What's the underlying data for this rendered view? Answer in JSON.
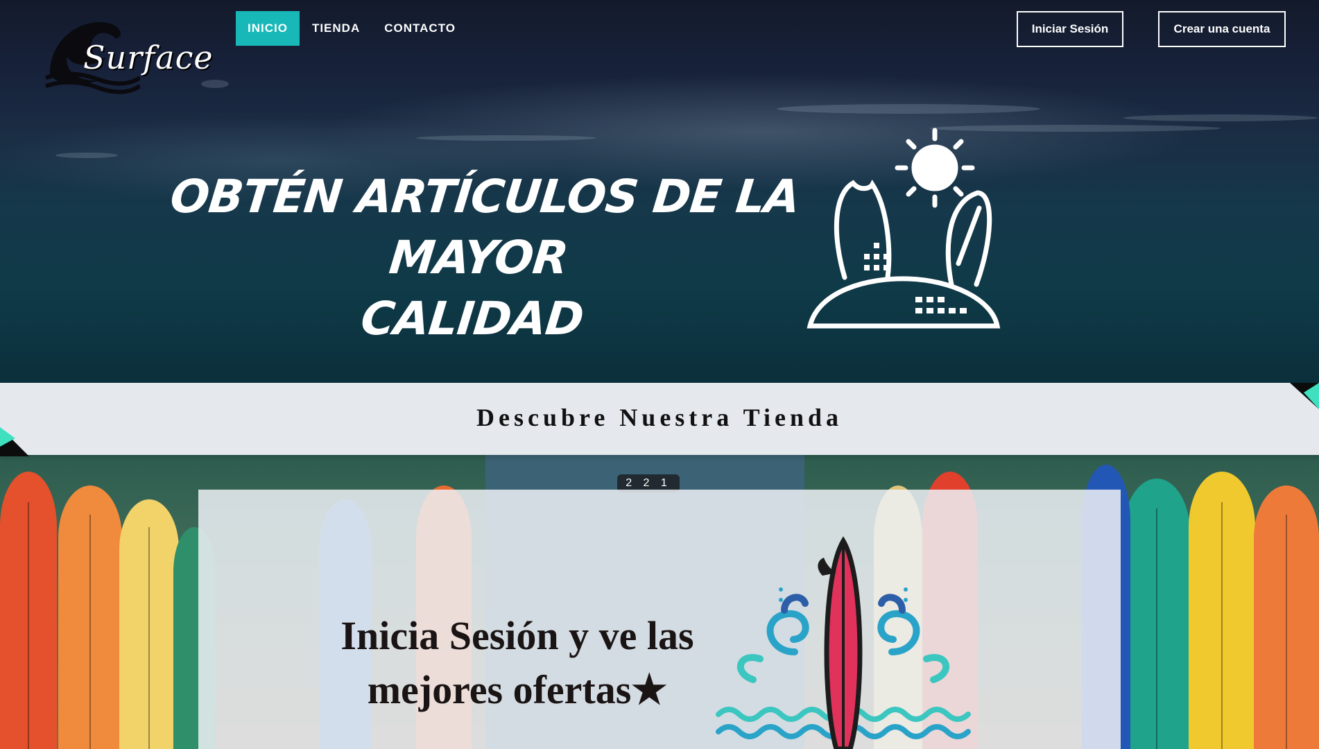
{
  "brand": {
    "name": "Surface"
  },
  "nav": {
    "items": [
      {
        "label": "INICIO",
        "active": true
      },
      {
        "label": "TIENDA",
        "active": false
      },
      {
        "label": "CONTACTO",
        "active": false
      }
    ]
  },
  "auth": {
    "login_label": "Iniciar Sesión",
    "signup_label": "Crear una cuenta"
  },
  "hero": {
    "headline_line1": "OBTÉN ARTÍCULOS DE LA MAYOR",
    "headline_line2": "CALIDAD",
    "icon": "beach-surfboards-icon"
  },
  "banner": {
    "title": "Descubre Nuestra Tienda"
  },
  "surf_wall": {
    "house_number": "2 2 1"
  },
  "promo": {
    "headline_line1": "Inicia Sesión y ve las",
    "headline_line2": "mejores ofertas★",
    "icon": "surfboard-wave-icon"
  },
  "colors": {
    "accent": "#18b8b8",
    "banner_bg": "#e5e9ee",
    "corner_accent": "#3ee0c0"
  }
}
